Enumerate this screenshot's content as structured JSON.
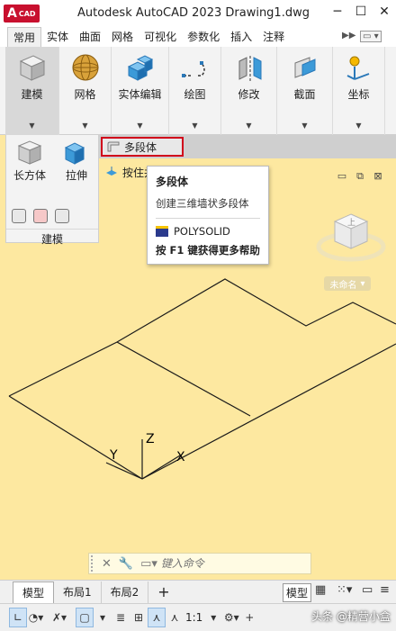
{
  "titlebar": {
    "logo_big": "A",
    "logo_small": "CAD",
    "title": "Autodesk AutoCAD 2023   Drawing1.dwg",
    "min": "─",
    "max": "☐",
    "close": "✕"
  },
  "tabs": [
    "常用",
    "实体",
    "曲面",
    "网格",
    "可视化",
    "参数化",
    "插入",
    "注释"
  ],
  "ribbon": {
    "buttons": [
      {
        "label": "建模"
      },
      {
        "label": "网格"
      },
      {
        "label": "实体编辑"
      },
      {
        "label": "绘图"
      },
      {
        "label": "修改"
      },
      {
        "label": "截面"
      },
      {
        "label": "坐标"
      }
    ]
  },
  "subpanel": {
    "box_label": "长方体",
    "extrude_label": "拉伸",
    "title": "建模"
  },
  "menu": {
    "polysolid": "多段体",
    "presspull": "按住并"
  },
  "tooltip": {
    "title": "多段体",
    "description": "创建三维墙状多段体",
    "command": "POLYSOLID",
    "help": "按 F1 键获得更多帮助"
  },
  "viewcube": {
    "face_label": "上",
    "unnamed_label": "未命名"
  },
  "axes": {
    "x": "X",
    "y": "Y",
    "z": "Z"
  },
  "cmdline": {
    "placeholder": "键入命令"
  },
  "layout_tabs": [
    "模型",
    "布局1",
    "布局2"
  ],
  "status": {
    "model": "模型",
    "scale": "1:1",
    "watermark": "头条 @精营小盒"
  },
  "colors": {
    "viewport_bg": "#fde8a0",
    "highlight_border": "#d0021b",
    "logo_red": "#c8102e"
  }
}
